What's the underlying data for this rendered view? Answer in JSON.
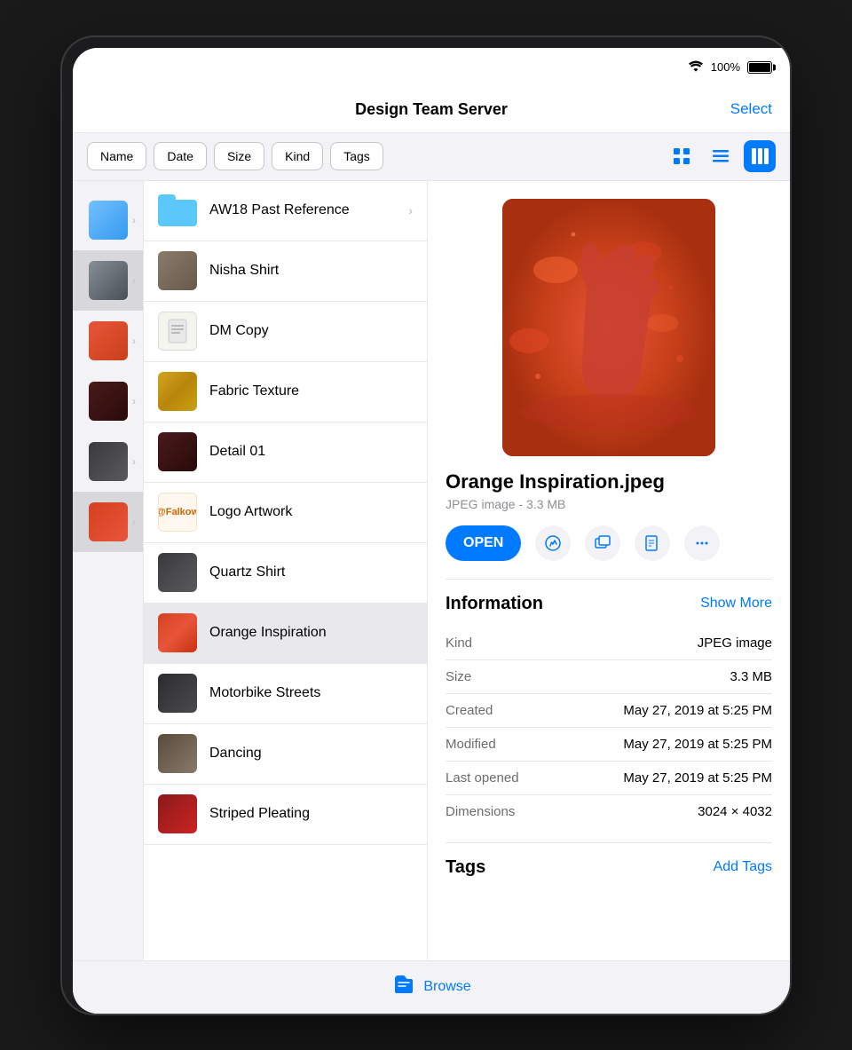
{
  "device": {
    "battery": "100%",
    "wifi": "📶"
  },
  "header": {
    "title": "Design Team Server",
    "select_label": "Select"
  },
  "sort": {
    "buttons": [
      "Name",
      "Date",
      "Size",
      "Kind",
      "Tags"
    ]
  },
  "view_modes": {
    "grid_icon": "⊞",
    "list_icon": "☰",
    "column_icon": "⊟",
    "active": "column"
  },
  "files": [
    {
      "id": "aw18",
      "name": "AW18 Past Reference",
      "type": "folder",
      "has_chevron": true
    },
    {
      "id": "nisha",
      "name": "Nisha Shirt",
      "type": "image",
      "color": "shirt"
    },
    {
      "id": "dm",
      "name": "DM Copy",
      "type": "doc",
      "color": "doc"
    },
    {
      "id": "fabric",
      "name": "Fabric Texture",
      "type": "image",
      "color": "gold"
    },
    {
      "id": "detail",
      "name": "Detail 01",
      "type": "image",
      "color": "dark"
    },
    {
      "id": "logo",
      "name": "Logo Artwork",
      "type": "image",
      "color": "logo"
    },
    {
      "id": "quartz",
      "name": "Quartz Shirt",
      "type": "image",
      "color": "shirt"
    },
    {
      "id": "orange",
      "name": "Orange Inspiration",
      "type": "image",
      "color": "orange",
      "selected": true
    },
    {
      "id": "moto",
      "name": "Motorbike Streets",
      "type": "image",
      "color": "street"
    },
    {
      "id": "dancing",
      "name": "Dancing",
      "type": "image",
      "color": "dance"
    },
    {
      "id": "striped",
      "name": "Striped Pleating",
      "type": "image",
      "color": "pleating"
    }
  ],
  "preview": {
    "file_name": "Orange Inspiration.jpeg",
    "file_type": "JPEG image",
    "file_size": "3.3 MB",
    "open_label": "OPEN",
    "actions": [
      "markup",
      "window",
      "pdf",
      "more"
    ]
  },
  "information": {
    "title": "Information",
    "show_more_label": "Show More",
    "rows": [
      {
        "label": "Kind",
        "value": "JPEG image"
      },
      {
        "label": "Size",
        "value": "3.3 MB"
      },
      {
        "label": "Created",
        "value": "May 27, 2019 at 5:25 PM"
      },
      {
        "label": "Modified",
        "value": "May 27, 2019 at 5:25 PM"
      },
      {
        "label": "Last opened",
        "value": "May 27, 2019 at 5:25 PM"
      },
      {
        "label": "Dimensions",
        "value": "3024 × 4032"
      }
    ]
  },
  "tags": {
    "title": "Tags",
    "add_label": "Add Tags"
  },
  "tab_bar": {
    "browse_icon": "📁",
    "browse_label": "Browse"
  },
  "sidebar_items": [
    {
      "color": "blue",
      "selected": false
    },
    {
      "color": "gray",
      "selected": true
    },
    {
      "color": "orange",
      "selected": false
    },
    {
      "color": "dark",
      "selected": false
    },
    {
      "color": "shirt",
      "selected": false
    },
    {
      "color": "orange2",
      "selected": true
    }
  ]
}
